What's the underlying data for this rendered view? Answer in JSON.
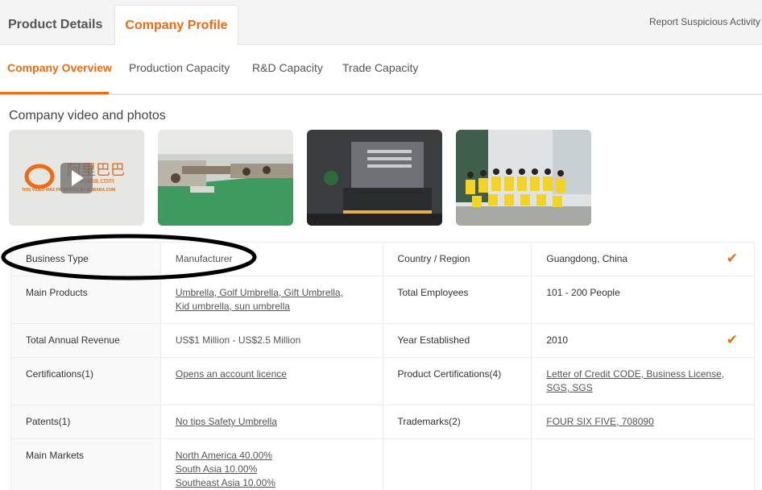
{
  "top_tabs": {
    "product_details": "Product Details",
    "company_profile": "Company Profile",
    "report": "Report Suspicious Activity"
  },
  "sub_tabs": [
    "Company Overview",
    "Production Capacity",
    "R&D Capacity",
    "Trade Capacity"
  ],
  "media": {
    "title": "Company video and photos",
    "video_logo_text": "阿里巴巴",
    "video_logo_sub": "alibaba.com",
    "video_caption": "THIS VIDEO WAS PRODUCED BY ALIBABA.COM"
  },
  "rows": [
    {
      "l1": "Business Type",
      "v1": [
        "Manufacturer"
      ],
      "v1_link": false,
      "l2": "Country / Region",
      "v2": [
        "Guangdong, China"
      ],
      "v2_link": false,
      "check": true
    },
    {
      "l1": "Main Products",
      "v1": [
        "Umbrella, Golf Umbrella, Gift Umbrella,",
        "Kid umbrella, sun umbrella"
      ],
      "v1_link": true,
      "l2": "Total Employees",
      "v2": [
        "101 - 200 People"
      ],
      "v2_link": false,
      "check": false
    },
    {
      "l1": "Total Annual Revenue",
      "v1": [
        "US$1 Million - US$2.5 Million"
      ],
      "v1_link": false,
      "l2": "Year Established",
      "v2": [
        "2010"
      ],
      "v2_link": false,
      "check": true
    },
    {
      "l1": "Certifications(1)",
      "v1": [
        "Opens an account licence"
      ],
      "v1_link": true,
      "l2": "Product Certifications(4)",
      "v2": [
        "Letter of Credit CODE, Business License,",
        "SGS, SGS"
      ],
      "v2_link": true,
      "check": false
    },
    {
      "l1": "Patents(1)",
      "v1": [
        "No tips Safety Umbrella"
      ],
      "v1_link": true,
      "l2": "Trademarks(2)",
      "v2": [
        "FOUR SIX FIVE, 708090"
      ],
      "v2_link": true,
      "check": false
    },
    {
      "l1": "Main Markets",
      "v1": [
        "North America 40.00%",
        "South Asia 10.00%",
        "Southeast Asia 10.00%"
      ],
      "v1_link": true,
      "l2": "",
      "v2": [],
      "v2_link": false,
      "check": false
    }
  ],
  "colors": {
    "accent": "#ef6a14"
  }
}
